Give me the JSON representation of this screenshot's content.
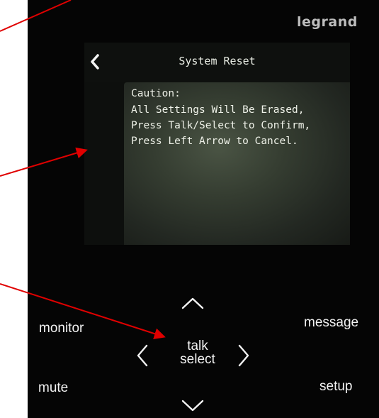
{
  "brand": "legrand",
  "screen": {
    "title": "System Reset",
    "back_icon": "chevron-left-icon",
    "message_lines": [
      "Caution:",
      "All Settings Will Be Erased,",
      "Press Talk/Select to Confirm,",
      "Press Left Arrow to Cancel."
    ]
  },
  "keypad": {
    "monitor": "monitor",
    "message": "message",
    "mute": "mute",
    "setup": "setup",
    "talk": "talk",
    "select": "select",
    "up_icon": "chevron-up-icon",
    "down_icon": "chevron-down-icon",
    "left_icon": "chevron-left-icon",
    "right_icon": "chevron-right-icon"
  },
  "colors": {
    "device_body": "#050505",
    "screen_text": "#eef1e8",
    "annotation_arrow": "#e00000"
  }
}
